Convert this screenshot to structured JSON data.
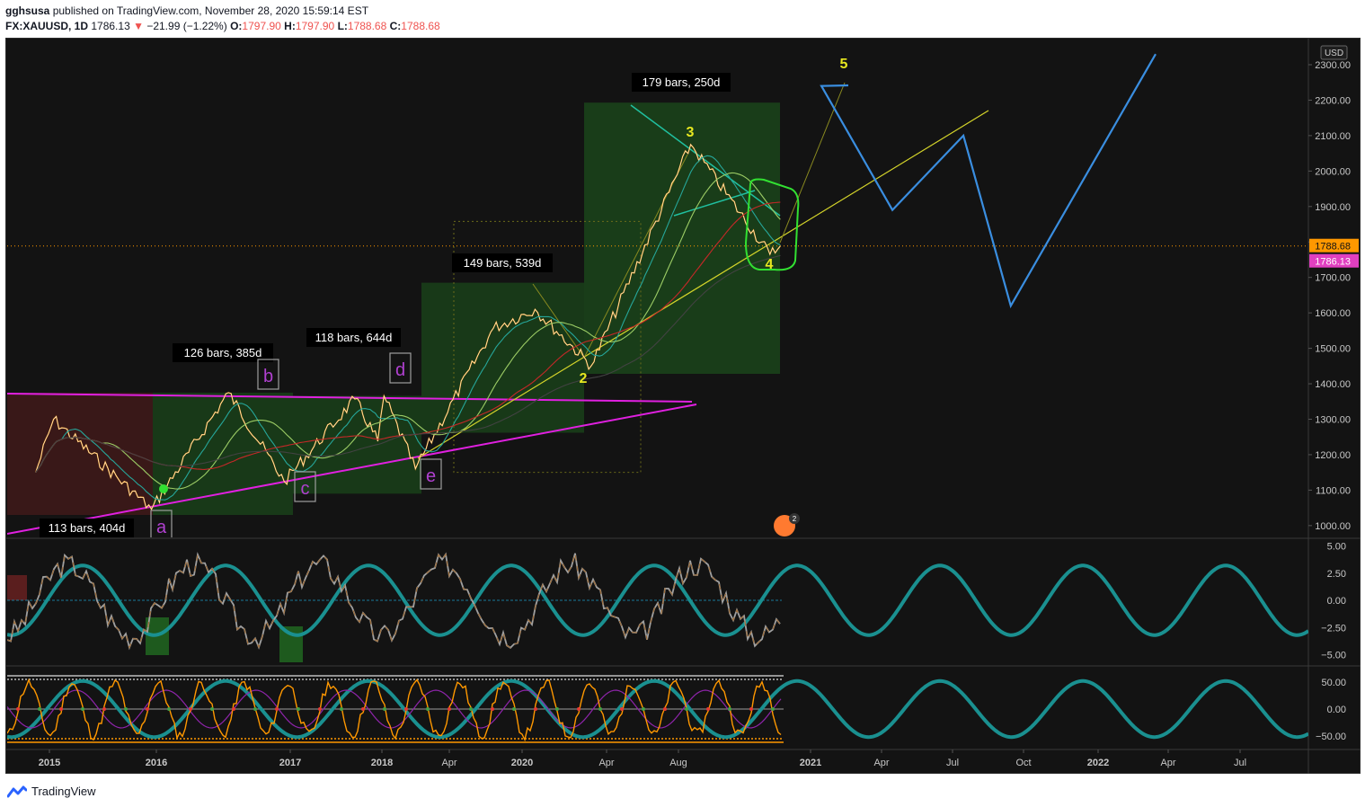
{
  "header": {
    "publisher": "gghsusa",
    "published_text": "published on TradingView.com, November 28, 2020 15:59:14 EST",
    "symbol": "FX:XAUUSD, 1D",
    "last": "1786.13",
    "change_arrow": "▼",
    "change": "−21.99 (−1.22%)",
    "o_label": "O:",
    "o_value": "1797.90",
    "h_label": "H:",
    "h_value": "1797.90",
    "l_label": "L:",
    "l_value": "1788.68",
    "c_label": "C:",
    "c_value": "1788.68"
  },
  "footer": {
    "brand": "TradingView",
    "logo_icon": "tradingview-logo-icon"
  },
  "price_axis": {
    "currency": "USD",
    "ticks": [
      "2300.00",
      "2200.00",
      "2100.00",
      "2000.00",
      "1900.00",
      "1800.00",
      "1700.00",
      "1600.00",
      "1500.00",
      "1400.00",
      "1300.00",
      "1200.00",
      "1100.00",
      "1000.00"
    ],
    "last_close_tag": "1788.68",
    "last_price_tag": "1786.13"
  },
  "osc1_axis": {
    "ticks": [
      "5.00",
      "2.50",
      "0.00",
      "−2.50",
      "−5.00"
    ]
  },
  "osc2_axis": {
    "ticks": [
      "50.00",
      "0.00",
      "−50.00"
    ]
  },
  "time_axis": {
    "ticks": [
      "2015",
      "2016",
      "2017",
      "2018",
      "Apr",
      "2020",
      "Apr",
      "Aug",
      "2021",
      "Apr",
      "Jul",
      "Oct",
      "2022",
      "Apr",
      "Jul"
    ]
  },
  "box_labels": [
    "113 bars, 404d",
    "126 bars, 385d",
    "118 bars, 644d",
    "149 bars, 539d",
    "179 bars, 250d"
  ],
  "wave_labels": [
    "a",
    "b",
    "c",
    "d",
    "e"
  ],
  "impulse_labels": [
    "2",
    "3",
    "4",
    "5"
  ],
  "colors": {
    "background": "#131313",
    "green_box": "#1e5a1e",
    "red_box": "#5a1e1e",
    "magenta": "#e020e0",
    "yellow": "#d4d42a",
    "blue_projection": "#3a8ee0",
    "teal_cycle": "#1a9090",
    "tag_orange": "#ff9800",
    "tag_magenta": "#e040c0"
  },
  "chart_data": {
    "type": "line",
    "symbol": "FX:XAUUSD",
    "interval": "1D",
    "y_range": [
      950,
      2330
    ],
    "major_swing_points": [
      {
        "x": "2014-11",
        "y": 1150
      },
      {
        "x": "2015-01",
        "y": 1300
      },
      {
        "x": "2015-12",
        "y": 1046
      },
      {
        "x": "2016-07",
        "y": 1375
      },
      {
        "x": "2016-12",
        "y": 1124
      },
      {
        "x": "2017-09",
        "y": 1357
      },
      {
        "x": "2017-12",
        "y": 1238
      },
      {
        "x": "2018-01",
        "y": 1366
      },
      {
        "x": "2018-08",
        "y": 1160
      },
      {
        "x": "2019-09",
        "y": 1557
      },
      {
        "x": "2020-01",
        "y": 1610
      },
      {
        "x": "2020-03",
        "y": 1451
      },
      {
        "x": "2020-08",
        "y": 2075
      },
      {
        "x": "2020-11",
        "y": 1765
      },
      {
        "x": "2020-11-27",
        "y": 1788.68
      }
    ],
    "projection": [
      {
        "x": "2021-01",
        "y": 2240
      },
      {
        "x": "2021-04",
        "y": 1890
      },
      {
        "x": "2021-07",
        "y": 2100
      },
      {
        "x": "2021-09",
        "y": 1620
      },
      {
        "x": "2022-03",
        "y": 2330
      }
    ],
    "series": [
      {
        "name": "",
        "values": [
          1150,
          1300,
          1046,
          1375,
          1124,
          1357,
          1238,
          1366,
          1160,
          1557,
          1610,
          1451,
          2075,
          1765,
          1788.68
        ]
      }
    ],
    "osc1_range": [
      -5.5,
      5.5
    ],
    "osc2_range": [
      -65,
      65
    ],
    "grid": false,
    "price_scale": "right"
  }
}
